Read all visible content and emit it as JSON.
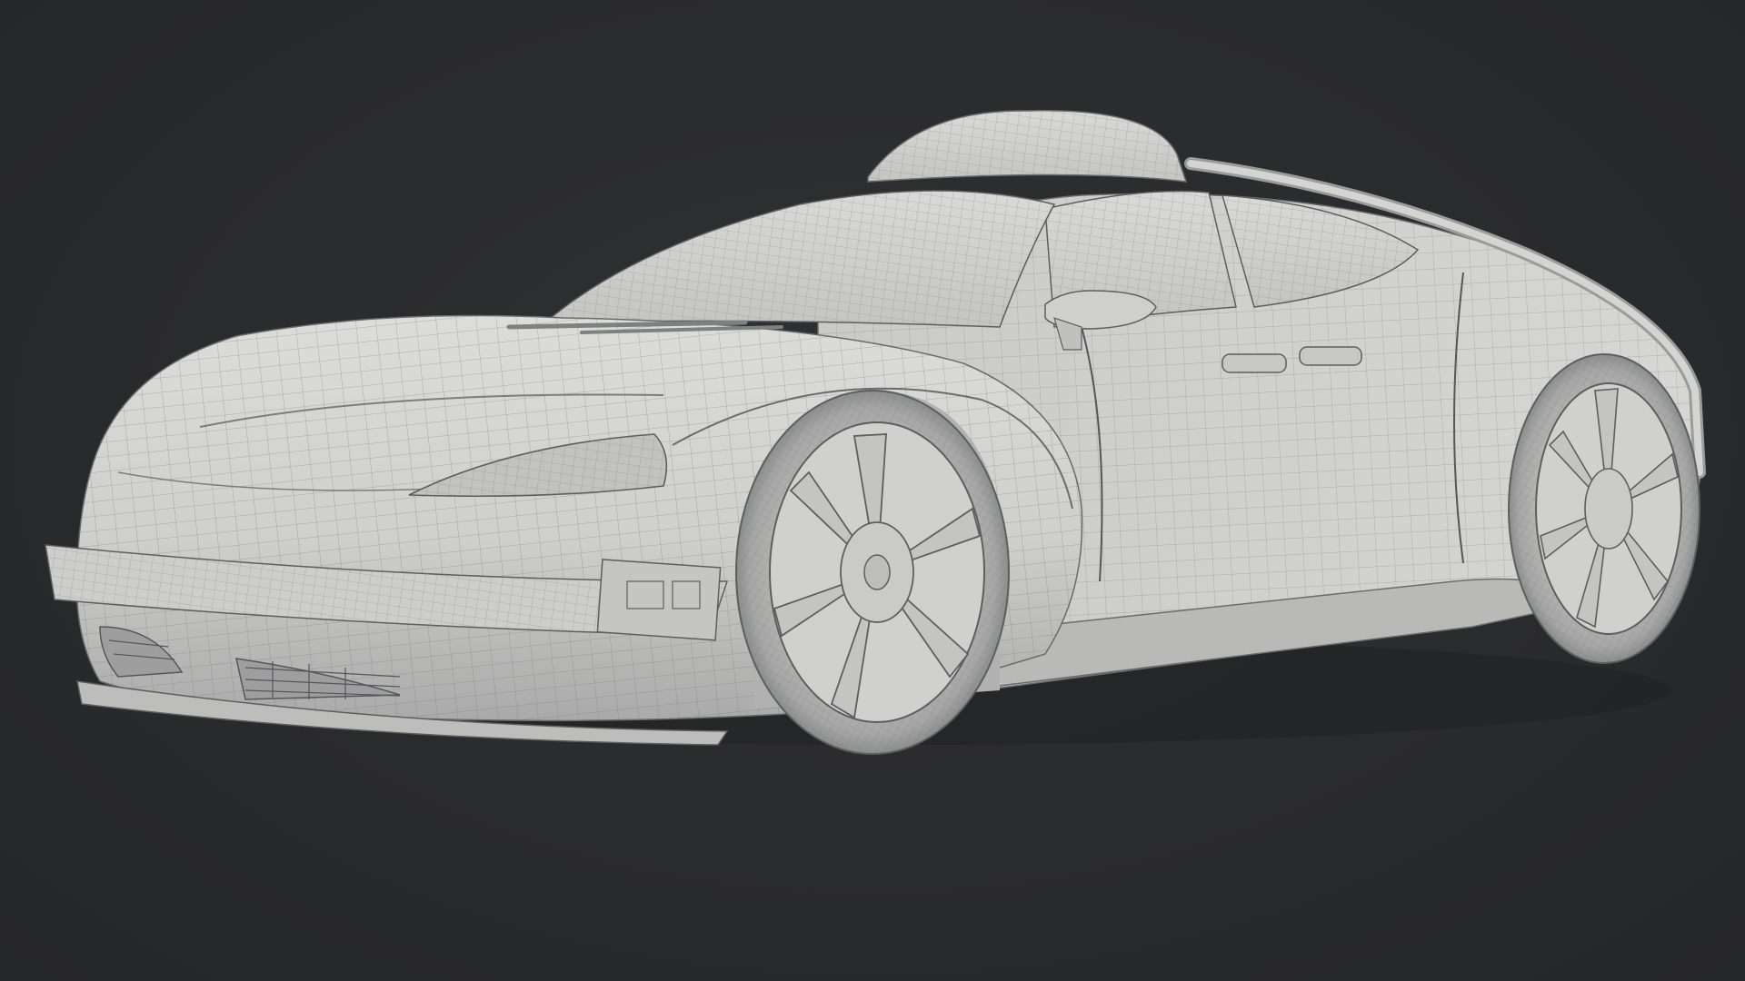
{
  "scene": {
    "subject": "car-wireframe-render",
    "background_color": "#2a2b2d",
    "body_color": "#d2d2d0",
    "wire_color": "#6e6f70",
    "shadow_color": "#9a9b9b"
  }
}
